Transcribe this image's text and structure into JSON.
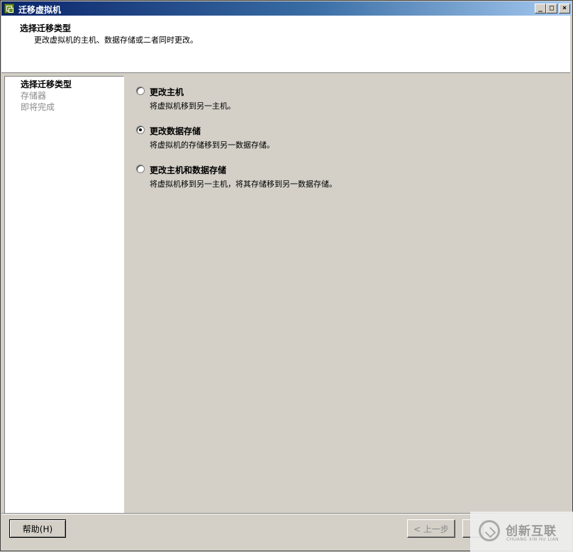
{
  "window": {
    "title": "迁移虚拟机",
    "controls": {
      "minimize": "_",
      "maximize": "□",
      "close": "×"
    }
  },
  "header": {
    "title": "选择迁移类型",
    "subtitle": "更改虚拟机的主机、数据存储或二者同时更改。"
  },
  "steps": [
    {
      "label": "选择迁移类型",
      "active": true
    },
    {
      "label": "存储器",
      "active": false
    },
    {
      "label": "即将完成",
      "active": false
    }
  ],
  "options": [
    {
      "label": "更改主机",
      "description": "将虚拟机移到另一主机。",
      "checked": false
    },
    {
      "label": "更改数据存储",
      "description": "将虚拟机的存储移到另一数据存储。",
      "checked": true
    },
    {
      "label": "更改主机和数据存储",
      "description": "将虚拟机移到另一主机，将其存储移到另一数据存储。",
      "checked": false
    }
  ],
  "footer": {
    "help_label": "帮助(H)",
    "back_label": "< 上一步"
  },
  "watermark": {
    "text_cn": "创新互联",
    "text_en": "CHUANG XIN HU LIAN"
  }
}
